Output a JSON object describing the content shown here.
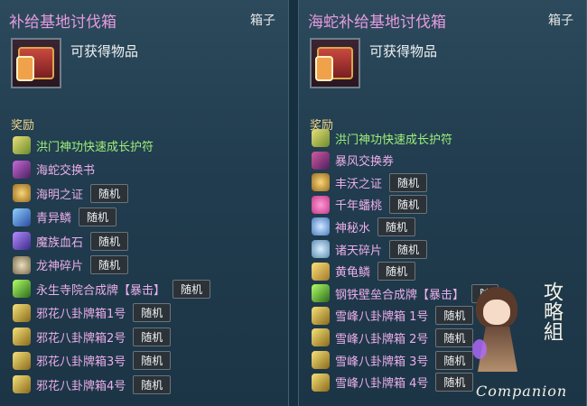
{
  "left": {
    "title": "补给基地讨伐箱",
    "box_label": "箱子",
    "obtain_label": "可获得物品",
    "reward_header": "奖励",
    "rewards": [
      {
        "name": "洪门神功快速成长护符",
        "color": "green",
        "icon": "talisman-icon",
        "badge": ""
      },
      {
        "name": "海蛇交换书",
        "color": "pink",
        "icon": "exchange-book-icon",
        "badge": ""
      },
      {
        "name": "海明之证",
        "color": "pink",
        "icon": "medal-icon",
        "badge": "随机"
      },
      {
        "name": "青异鳞",
        "color": "pink",
        "icon": "scale-icon",
        "badge": "随机"
      },
      {
        "name": "魔族血石",
        "color": "pink",
        "icon": "bloodstone-icon",
        "badge": "随机"
      },
      {
        "name": "龙神碎片",
        "color": "pink",
        "icon": "dragon-shard-icon",
        "badge": "随机"
      },
      {
        "name": "永生寺院合成牌【暴击】",
        "color": "pink",
        "icon": "synth-card-icon",
        "badge": "随机"
      },
      {
        "name": "邪花八卦牌箱1号",
        "color": "pink",
        "icon": "bagua-box-icon",
        "badge": "随机"
      },
      {
        "name": "邪花八卦牌箱2号",
        "color": "pink",
        "icon": "bagua-box-icon",
        "badge": "随机"
      },
      {
        "name": "邪花八卦牌箱3号",
        "color": "pink",
        "icon": "bagua-box-icon",
        "badge": "随机"
      },
      {
        "name": "邪花八卦牌箱4号",
        "color": "pink",
        "icon": "bagua-box-icon",
        "badge": "随机"
      }
    ]
  },
  "right": {
    "title": "海蛇补给基地讨伐箱",
    "box_label": "箱子",
    "obtain_label": "可获得物品",
    "reward_header": "奖励",
    "rewards": [
      {
        "name": "洪门神功快速成长护符",
        "color": "green",
        "icon": "talisman-icon",
        "badge": ""
      },
      {
        "name": "暴风交换券",
        "color": "pink",
        "icon": "exchange-ticket-icon",
        "badge": ""
      },
      {
        "name": "丰沃之证",
        "color": "pink",
        "icon": "medal-icon",
        "badge": "随机"
      },
      {
        "name": "千年蟠桃",
        "color": "pink",
        "icon": "peach-icon",
        "badge": "随机"
      },
      {
        "name": "神秘水",
        "color": "pink",
        "icon": "water-icon",
        "badge": "随机"
      },
      {
        "name": "诸天碎片",
        "color": "pink",
        "icon": "heaven-shard-icon",
        "badge": "随机"
      },
      {
        "name": "黄龟鳞",
        "color": "pink",
        "icon": "turtle-scale-icon",
        "badge": "随机"
      },
      {
        "name": "钢铁壁垒合成牌【暴击】",
        "color": "pink",
        "icon": "synth-card-icon",
        "badge": "随"
      },
      {
        "name": "雪峰八卦牌箱 1号",
        "color": "pink",
        "icon": "bagua-box-icon",
        "badge": "随机"
      },
      {
        "name": "雪峰八卦牌箱 2号",
        "color": "pink",
        "icon": "bagua-box-icon",
        "badge": "随机"
      },
      {
        "name": "雪峰八卦牌箱 3号",
        "color": "pink",
        "icon": "bagua-box-icon",
        "badge": "随机"
      },
      {
        "name": "雪峰八卦牌箱 4号",
        "color": "pink",
        "icon": "bagua-box-icon",
        "badge": "随机"
      }
    ]
  },
  "watermark": {
    "cjk": "攻略組",
    "text": "Companion"
  },
  "colors": {
    "title": "#e79adf",
    "green_item": "#9ef07a",
    "pink_item": "#ecaeea",
    "reward_header": "#f0d68a"
  }
}
